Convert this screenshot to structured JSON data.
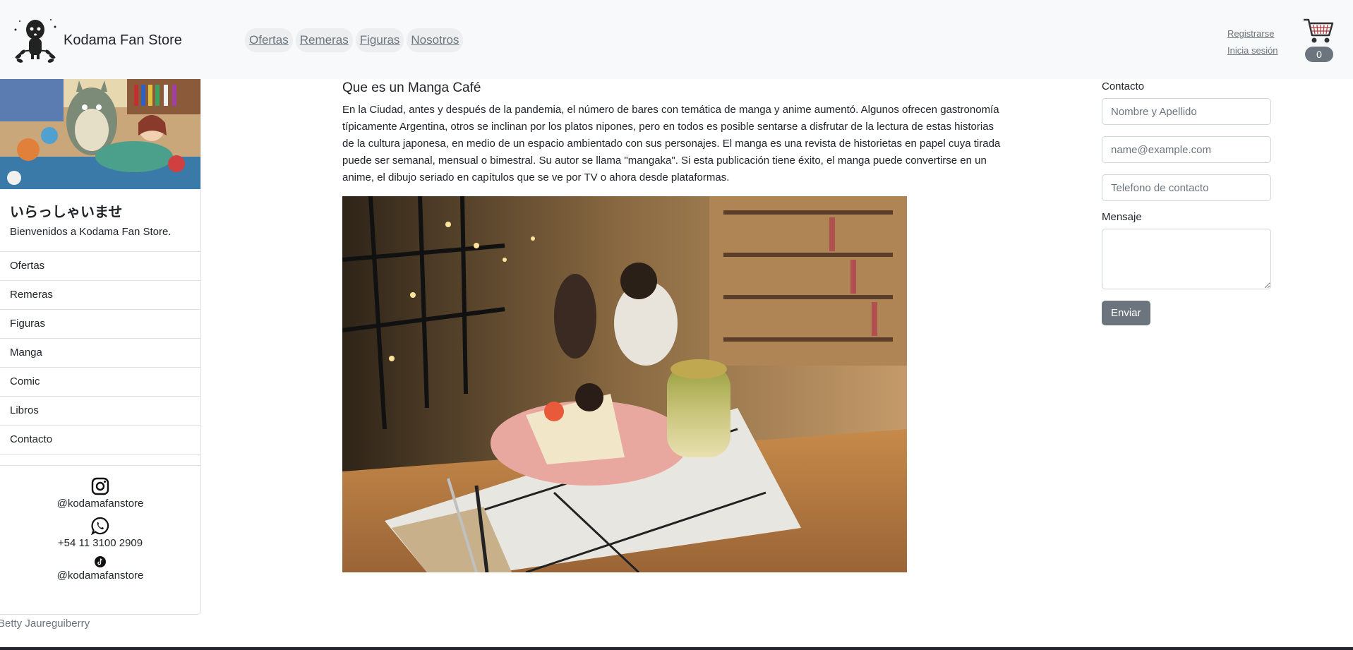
{
  "brand": {
    "name": "Kodama Fan Store"
  },
  "nav": {
    "links": [
      "Ofertas",
      "Remeras",
      "Figuras",
      "Nosotros"
    ]
  },
  "auth": {
    "register": "Registrarse",
    "login": "Inicia sesión"
  },
  "cart": {
    "count": "0",
    "icon": "shopping-cart-icon"
  },
  "sidebar": {
    "welcome_title": "いらっしゃいませ",
    "welcome_text": "Bienvenidos a Kodama Fan Store.",
    "menu": [
      "Ofertas",
      "Remeras",
      "Figuras",
      "Manga",
      "Comic",
      "Libros",
      "Contacto"
    ],
    "social": [
      {
        "icon": "instagram-icon",
        "text": "@kodamafanstore"
      },
      {
        "icon": "whatsapp-icon",
        "text": "+54 11 3100 2909"
      },
      {
        "icon": "tiktok-icon",
        "text": "@kodamafanstore"
      }
    ]
  },
  "footer": {
    "credit": "Betty Jaureguiberry"
  },
  "main": {
    "title": "Que es un Manga Café",
    "text": "En la Ciudad, antes y después de la pandemia, el número de bares con temática de manga y anime aumentó. Algunos ofrecen gastronomía típicamente Argentina, otros se inclinan por los platos nipones, pero en todos es posible sentarse a disfrutar de la lectura de estas historias de la cultura japonesa, en medio de un espacio ambientado con sus personajes. El manga es una revista de historietas en papel cuya tirada puede ser semanal, mensual o bimestral. Su autor se llama \"mangaka\". Si esta publicación tiene éxito, el manga puede convertirse en un anime, el dibujo seriado en capítulos que se ve por TV o ahora desde plataformas."
  },
  "contact": {
    "label": "Contacto",
    "name_placeholder": "Nombre y Apellido",
    "email_placeholder": "name@example.com",
    "phone_placeholder": "Telefono de contacto",
    "message_label": "Mensaje",
    "send_label": "Enviar"
  },
  "colors": {
    "navbar_bg": "#f8f9fa",
    "secondary": "#6c757d",
    "text": "#212529"
  }
}
